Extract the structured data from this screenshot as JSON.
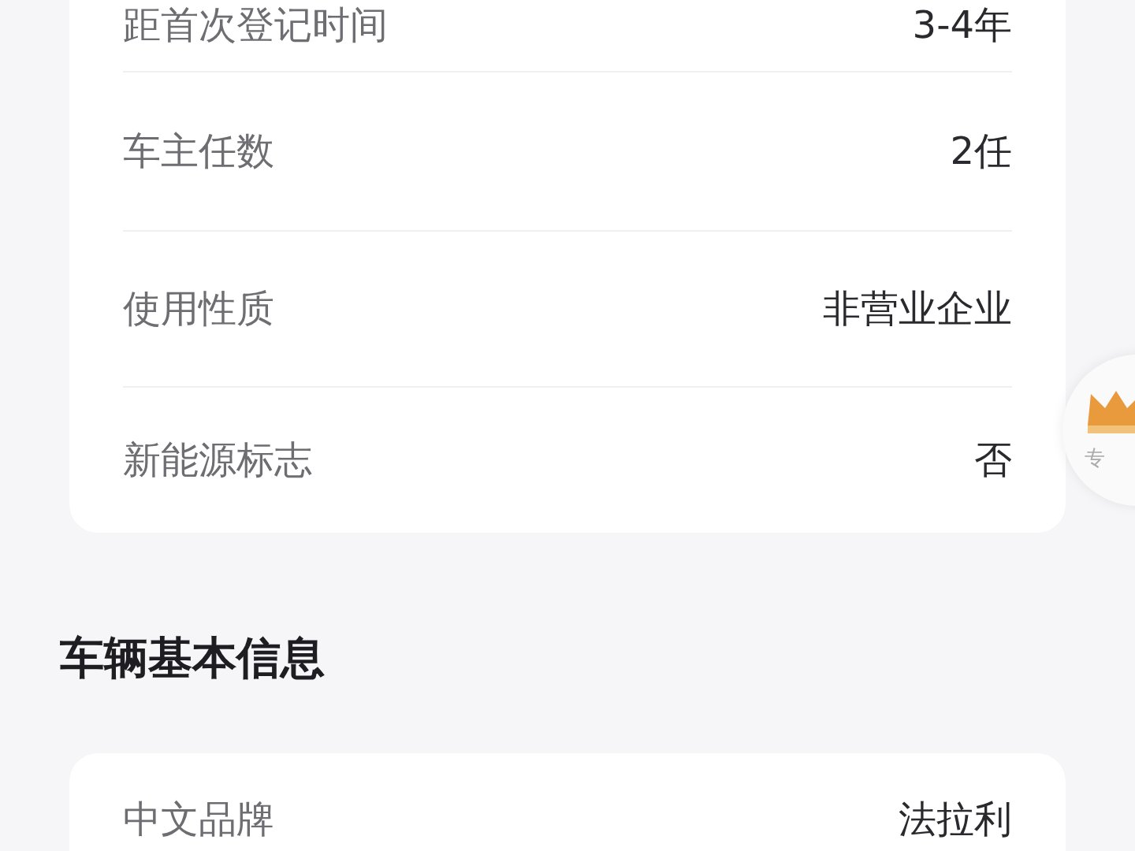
{
  "sections": [
    {
      "rows": [
        {
          "label": "距首次登记时间",
          "value": "3-4年"
        },
        {
          "label": "车主任数",
          "value": "2任"
        },
        {
          "label": "使用性质",
          "value": "非营业企业"
        },
        {
          "label": "新能源标志",
          "value": "否"
        }
      ]
    },
    {
      "title": "车辆基本信息",
      "rows": [
        {
          "label": "中文品牌",
          "value": "法拉利"
        }
      ]
    }
  ],
  "floating_badge": {
    "label": "专"
  }
}
